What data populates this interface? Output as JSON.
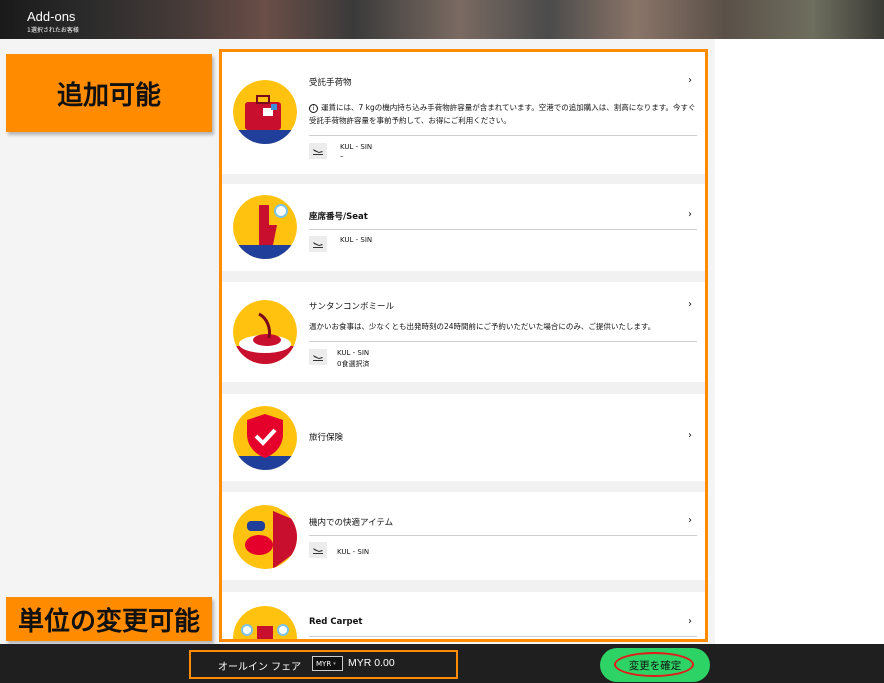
{
  "header": {
    "title": "Add-ons",
    "subtitle": "1選択されたお客様"
  },
  "callouts": {
    "top": "追加可能",
    "bottom": "単位の変更可能"
  },
  "cards": [
    {
      "name": "受託手荷物",
      "note": "運賃には、7 kgの機内持ち込み手荷物許容量が含まれています。空港での追加購入は、割高になります。今すぐ受託手荷物許容量を事前予約して、お得にご利用ください。",
      "route": "KUL - SIN",
      "route_sub": "–",
      "icon": "luggage-icon"
    },
    {
      "name": "座席番号/Seat",
      "route": "KUL - SIN",
      "icon": "seat-icon"
    },
    {
      "name": "サンタンコンボミール",
      "note": "温かいお食事は、少なくとも出発時刻の24時間前にご予約いただいた場合にのみ、ご提供いたします。",
      "route": "KUL - SIN",
      "route_sub": "0食選択済",
      "icon": "meal-icon"
    },
    {
      "name": "旅行保険",
      "icon": "insurance-shield-icon"
    },
    {
      "name": "機内での快適アイテム",
      "route": "KUL - SIN",
      "icon": "comfort-kit-icon"
    },
    {
      "name": "Red Carpet",
      "icon": "red-carpet-icon"
    }
  ],
  "footer": {
    "fare_label": "オールイン フェア",
    "currency": "MYR",
    "amount": "MYR 0.00",
    "confirm_label": "変更を確定"
  },
  "colors": {
    "accent_orange": "#ff8c00",
    "confirm_green": "#2ed365",
    "highlight_red": "#e31b1b",
    "icon_yellow": "#ffc20e",
    "icon_blue": "#1f3f9b"
  }
}
